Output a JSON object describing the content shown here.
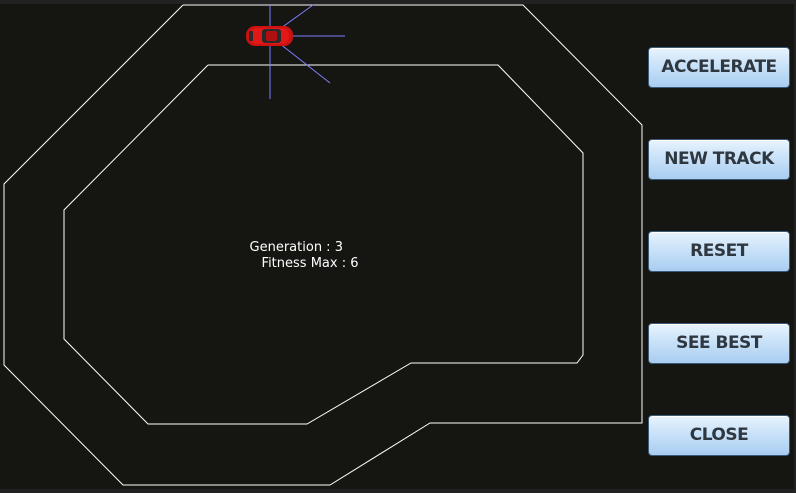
{
  "hud": {
    "generation_text": "Generation : 3",
    "fitness_text": "Fitness Max : 6"
  },
  "controls": {
    "accelerate_label": "ACCELERATE",
    "new_track_label": "NEW TRACK",
    "reset_label": "RESET",
    "see_best_label": "SEE BEST",
    "close_label": "CLOSE"
  },
  "colors": {
    "background": "#151512",
    "track_line": "#ffffff",
    "sensor_line": "#8080ff",
    "car_body": "#cc1111"
  },
  "icons": {
    "car": "car-icon"
  }
}
